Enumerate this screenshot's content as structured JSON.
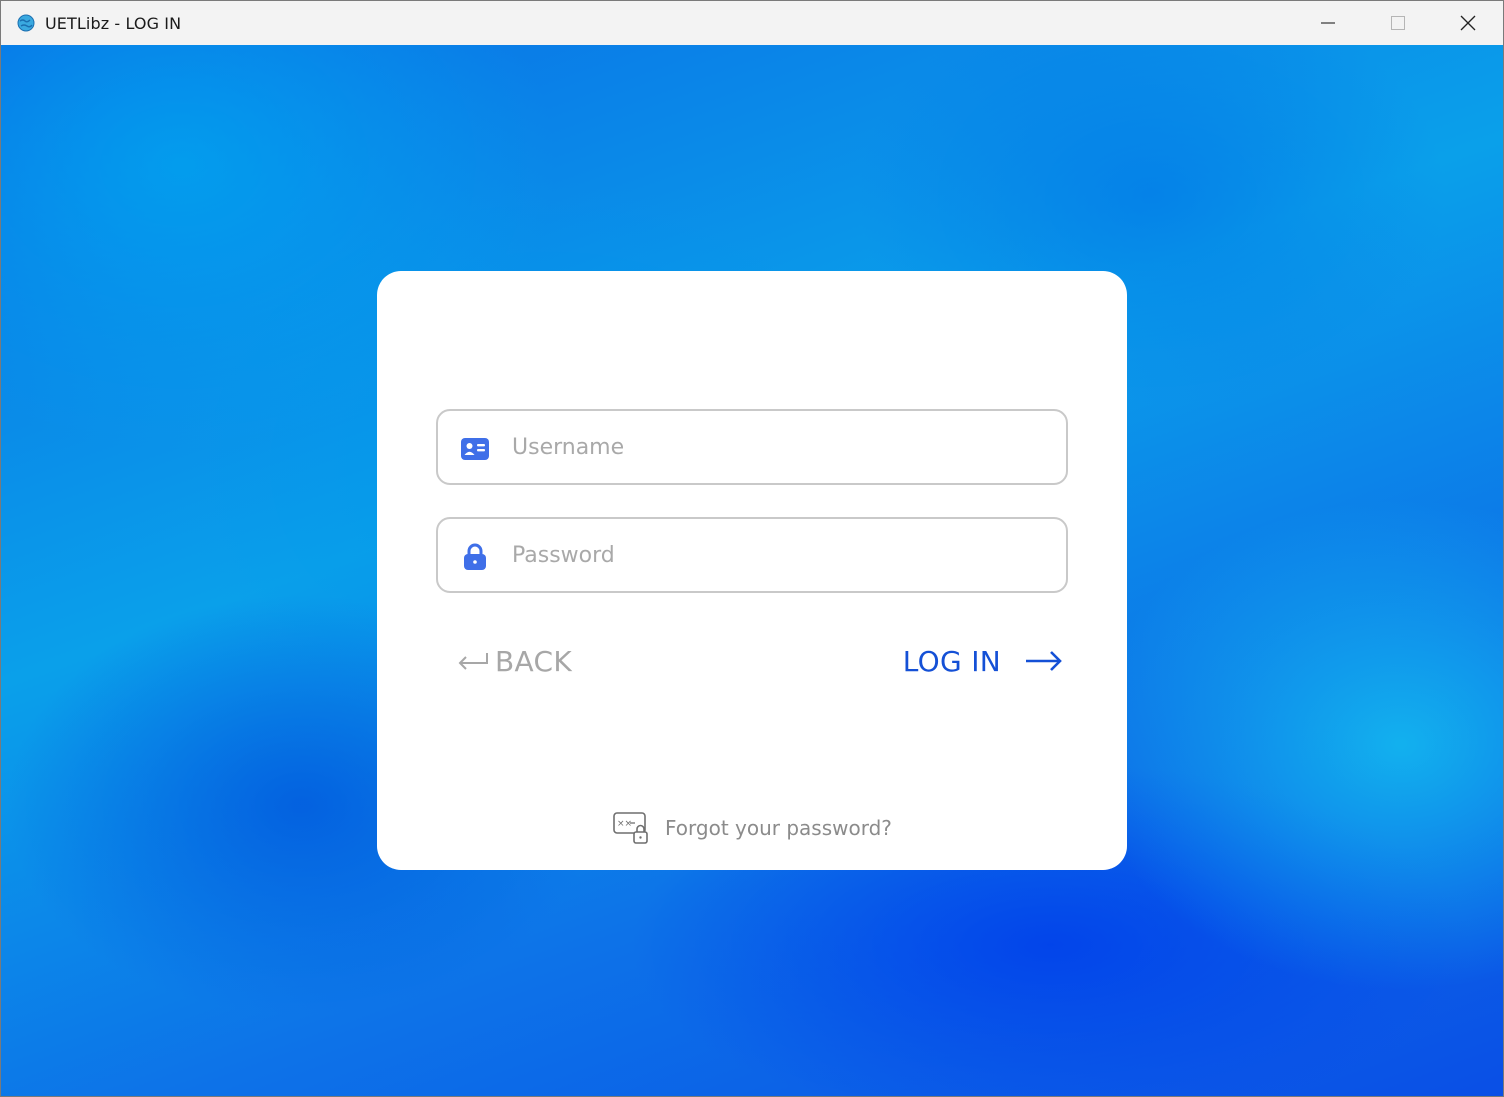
{
  "window": {
    "title": "UETLibz - LOG IN",
    "app_icon": "globe-icon",
    "controls": [
      "minimize-icon",
      "maximize-icon",
      "close-icon"
    ]
  },
  "login_form": {
    "username": {
      "icon": "id-card-icon",
      "placeholder": "Username",
      "value": ""
    },
    "password": {
      "icon": "lock-icon",
      "placeholder": "Password",
      "value": ""
    },
    "back_label": "BACK",
    "back_icon": "return-arrow-icon",
    "login_label": "LOG IN",
    "login_icon": "right-arrow-icon",
    "forgot_label": "Forgot your password?",
    "forgot_icon": "password-reset-icon"
  },
  "colors": {
    "accent": "#1450d6",
    "icon_blue": "#3f6fe8",
    "muted_text": "#a7a7a7",
    "background_blue": "#1a7de8"
  }
}
